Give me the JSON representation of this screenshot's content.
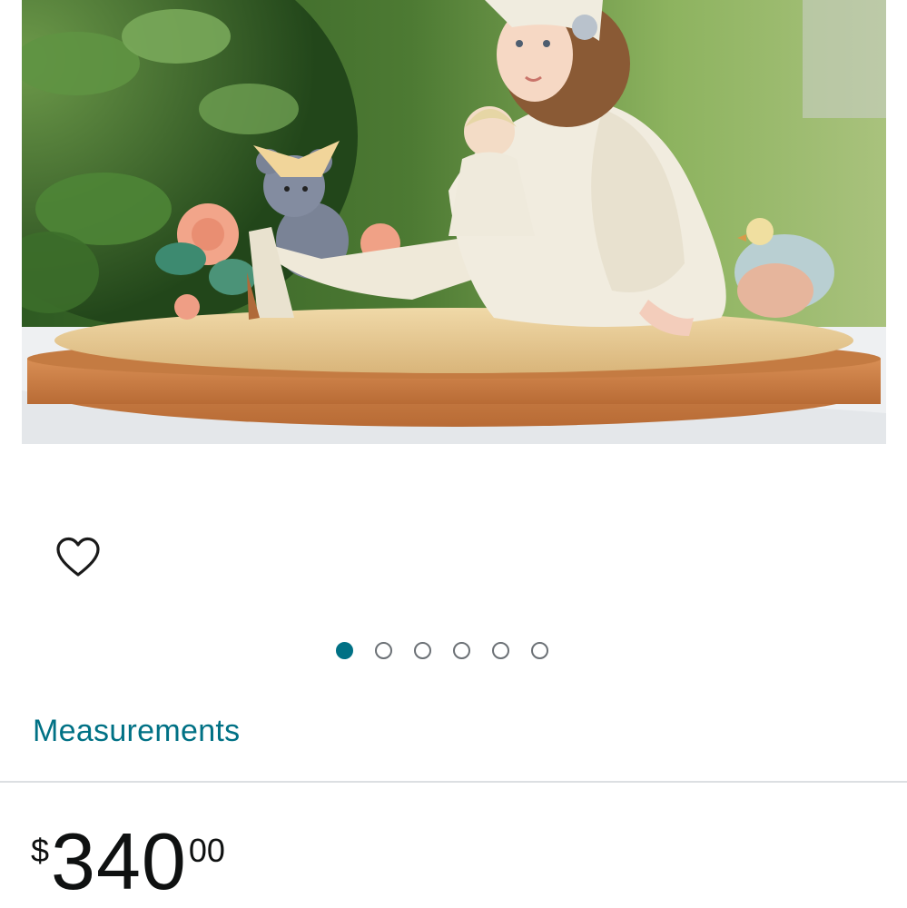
{
  "product": {
    "image_icon": "product-photo-figurine"
  },
  "wishlist": {
    "icon": "heart-outline-icon"
  },
  "carousel": {
    "total": 6,
    "active_index": 0,
    "active_color": "#007185"
  },
  "measurements": {
    "label": "Measurements",
    "color": "#007185"
  },
  "price": {
    "symbol": "$",
    "whole": "340",
    "fraction": "00"
  }
}
